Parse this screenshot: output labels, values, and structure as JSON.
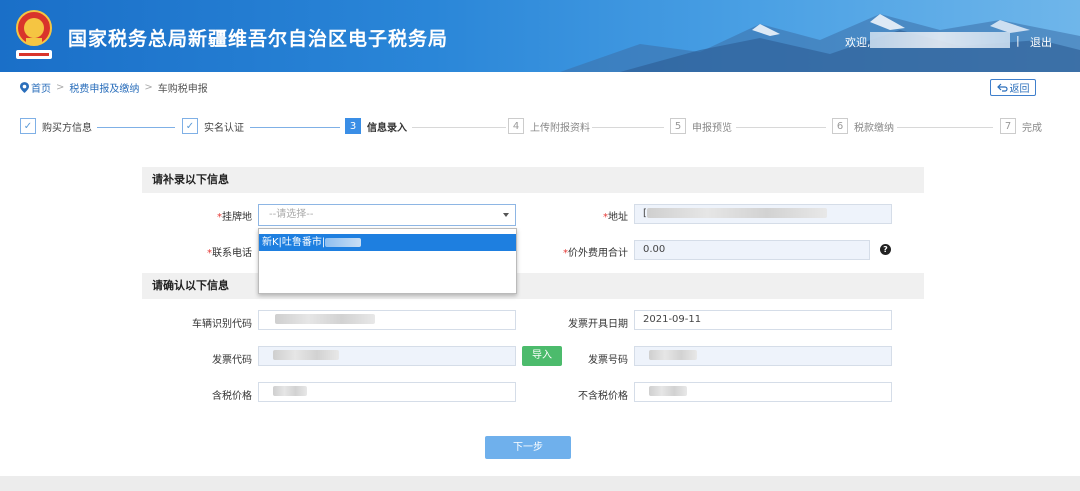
{
  "header": {
    "title": "国家税务总局新疆维吾尔自治区电子税务局",
    "welcome": "欢迎,",
    "separator": "|",
    "logout": "退出",
    "colors": {
      "primary": "#1a6fc8",
      "accent": "#3a8ee6"
    }
  },
  "breadcrumb": {
    "home": "首页",
    "level2": "税费申报及缴纳",
    "level3": "车购税申报",
    "arrow": ">"
  },
  "back_button": "返回",
  "steps": [
    {
      "num": "✓",
      "label": "购买方信息",
      "state": "done"
    },
    {
      "num": "✓",
      "label": "实名认证",
      "state": "done"
    },
    {
      "num": "3",
      "label": "信息录入",
      "state": "active"
    },
    {
      "num": "4",
      "label": "上传附报资料",
      "state": "todo"
    },
    {
      "num": "5",
      "label": "申报预览",
      "state": "todo"
    },
    {
      "num": "6",
      "label": "税款缴纳",
      "state": "todo"
    },
    {
      "num": "7",
      "label": "完成",
      "state": "todo"
    }
  ],
  "section1": {
    "title": "请补录以下信息",
    "plate_label": "挂牌地",
    "plate_placeholder": "--请选择--",
    "plate_option": "新K|吐鲁番市|",
    "address_label": "地址",
    "address_prefix": "[",
    "phone_label": "联系电话",
    "extra_fee_label": "价外费用合计",
    "extra_fee_value": "0.00",
    "help_icon": "?",
    "required_mark": "*"
  },
  "section2": {
    "title": "请确认以下信息",
    "vin_label": "车辆识别代码",
    "invoice_date_label": "发票开具日期",
    "invoice_date_value": "2021-09-11",
    "invoice_code_label": "发票代码",
    "import_button": "导入",
    "invoice_no_label": "发票号码",
    "tax_incl_label": "含税价格",
    "tax_excl_label": "不含税价格"
  },
  "next_button": "下一步"
}
